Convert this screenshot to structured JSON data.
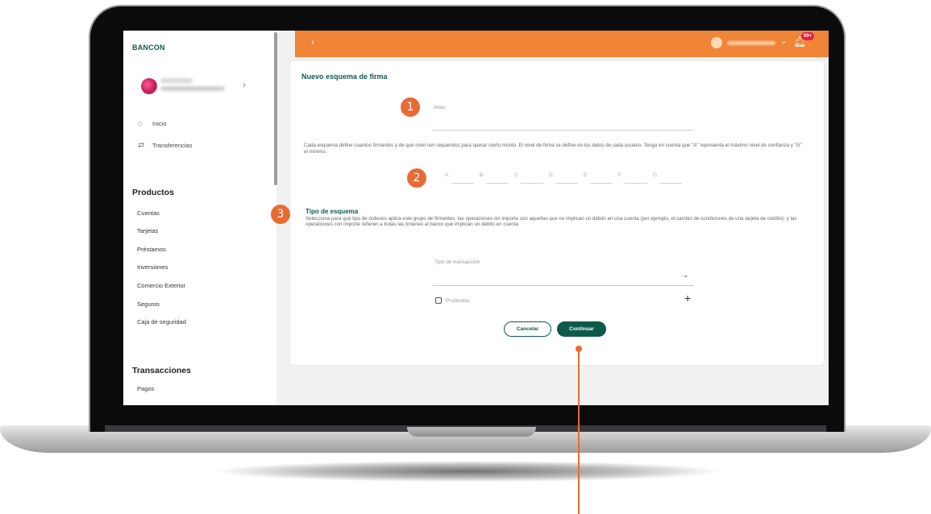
{
  "app": {
    "brand": "BANCON"
  },
  "sidebar": {
    "nav": [
      {
        "label": "Inicio",
        "icon": "home-icon"
      },
      {
        "label": "Transferencias",
        "icon": "transfer-icon"
      }
    ],
    "productos": {
      "title": "Productos",
      "items": [
        "Cuentas",
        "Tarjetas",
        "Préstamos",
        "Inversiones",
        "Comercio Exterior",
        "Seguros",
        "Caja de seguridad"
      ]
    },
    "transacciones": {
      "title": "Transacciones",
      "items": [
        "Pagos"
      ]
    }
  },
  "header": {
    "notification_count": "99+",
    "accent": "#f08537"
  },
  "form": {
    "title": "Nuevo esquema de firma",
    "alias_placeholder": "Alias",
    "description": "Cada esquema define cuantos firmantes y de qué nivel son requeridos para operar cierto monto. El nivel de firma se define en los datos de cada usuario. Tenga en cuenta que \"A\" representa el máximo nivel de confianza y \"G\" el mínimo.",
    "levels": [
      "A",
      "B",
      "C",
      "D",
      "E",
      "F",
      "G"
    ],
    "tipo_title": "Tipo de esquema",
    "tipo_desc": "Selecciona para qué tipo de órdenes aplica este grupo de firmantes. las operaciones sin importe son aquellas que no implican un débito en una cuenta (por ejemplo, el cambio de condiciones de una tarjeta de crédito); y las operaciones con importe refieren a todas las órdenes al banco que implican un débito en cuenta.",
    "transaction_label": "Tipo de transacción",
    "checkbox_label": "Productos",
    "cancel": "Cancelar",
    "continue": "Continuar",
    "brand_color": "#0d5a4a"
  },
  "steps": [
    "1",
    "2",
    "3"
  ]
}
